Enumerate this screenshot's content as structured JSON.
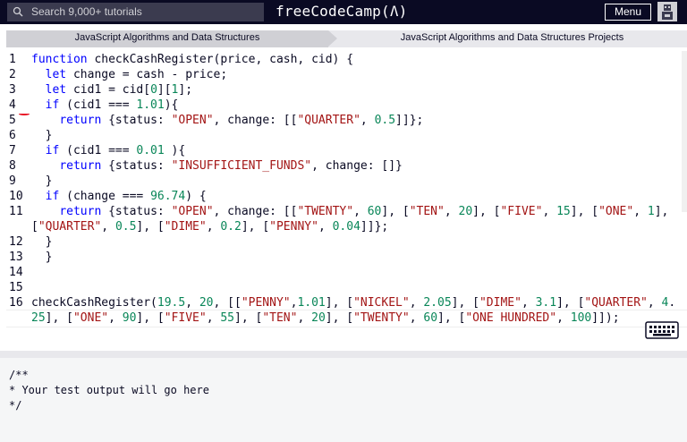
{
  "navbar": {
    "search_placeholder": "Search 9,000+ tutorials",
    "brand": "freeCodeCamp(Ʌ)",
    "menu_label": "Menu"
  },
  "breadcrumb": {
    "items": [
      {
        "label": "JavaScript Algorithms and Data Structures"
      },
      {
        "label": "JavaScript Algorithms and Data Structures Projects"
      }
    ]
  },
  "editor": {
    "line_numbers": [
      "1",
      "2",
      "3",
      "4",
      "5",
      "6",
      "7",
      "8",
      "9",
      "10",
      "11",
      "12",
      "13",
      "14",
      "15",
      "16"
    ],
    "lines": [
      "function checkCashRegister(price, cash, cid) {",
      "  let change = cash - price;",
      "  let cid1 = cid[0][1];",
      "  if (cid1 === 1.01){",
      "    return {status: \"OPEN\", change: [[\"QUARTER\", 0.5]]};",
      "  }",
      "  if (cid1 === 0.01 ){",
      "    return {status: \"INSUFFICIENT_FUNDS\", change: []}",
      "  }",
      "  if (change === 96.74) {",
      "    return {status: \"OPEN\", change: [[\"TWENTY\", 60], [\"TEN\", 20], [\"FIVE\", 15], [\"ONE\", 1],",
      "[\"QUARTER\", 0.5], [\"DIME\", 0.2], [\"PENNY\", 0.04]]};",
      "  }",
      "  }",
      "",
      "",
      "checkCashRegister(19.5, 20, [[\"PENNY\",1.01], [\"NICKEL\", 2.05], [\"DIME\", 3.1], [\"QUARTER\", 4.",
      "25], [\"ONE\", 90], [\"FIVE\", 55], [\"TEN\", 20], [\"TWENTY\", 60], [\"ONE HUNDRED\", 100]]);"
    ]
  },
  "output": {
    "lines": [
      "/**",
      "* Your test output will go here",
      "*/"
    ]
  },
  "icons": {
    "search": "search-icon",
    "avatar": "avatar-icon",
    "keyboard": "keyboard-icon"
  },
  "colors": {
    "navbar_bg": "#0a0a23",
    "keyword": "#0000ff",
    "string": "#a31515",
    "number": "#098658"
  }
}
